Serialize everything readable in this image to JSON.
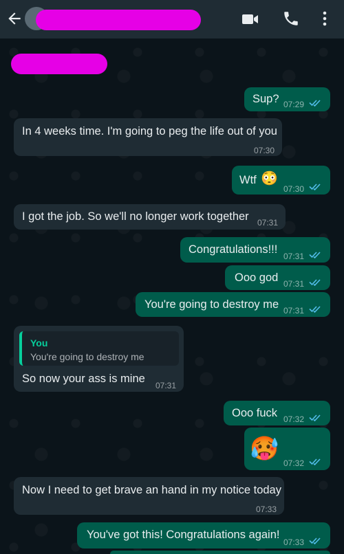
{
  "header": {
    "icons": [
      "back-icon",
      "video-call-icon",
      "voice-call-icon",
      "more-options-icon"
    ]
  },
  "messages": [
    {
      "direction": "out",
      "text": "Sup?",
      "time": "07:29"
    },
    {
      "direction": "in",
      "text": "In 4 weeks time. I'm going to peg the life out of you",
      "time": "07:30"
    },
    {
      "direction": "out",
      "text": "Wtf",
      "emoji": "😳",
      "time": "07:30"
    },
    {
      "direction": "in",
      "text": "I got the job. So we'll no longer work together",
      "time": "07:31"
    },
    {
      "direction": "out",
      "text": "Congratulations!!!",
      "time": "07:31"
    },
    {
      "direction": "out",
      "text": "Ooo god",
      "time": "07:31"
    },
    {
      "direction": "out",
      "text": "You're going to destroy me",
      "time": "07:31"
    },
    {
      "direction": "in",
      "text": "So now your ass is mine",
      "time": "07:31",
      "reply_to": {
        "author": "You",
        "text": "You're going to destroy me"
      }
    },
    {
      "direction": "out",
      "text": "Ooo fuck",
      "time": "07:32"
    },
    {
      "direction": "out",
      "text": "",
      "emoji": "🥵",
      "time": "07:32"
    },
    {
      "direction": "in",
      "text": "Now I need to get brave an hand in my notice today",
      "time": "07:33"
    },
    {
      "direction": "out",
      "text": "You've got this! Congratulations again!",
      "time": "07:33"
    }
  ],
  "colors": {
    "header_bg": "#1f2c34",
    "chat_bg": "#0b141a",
    "outgoing_bubble": "#005c4b",
    "incoming_bubble": "#1f2c34",
    "read_tick": "#53bdeb",
    "reply_accent": "#06cf9c",
    "redaction": "#e600e6"
  }
}
